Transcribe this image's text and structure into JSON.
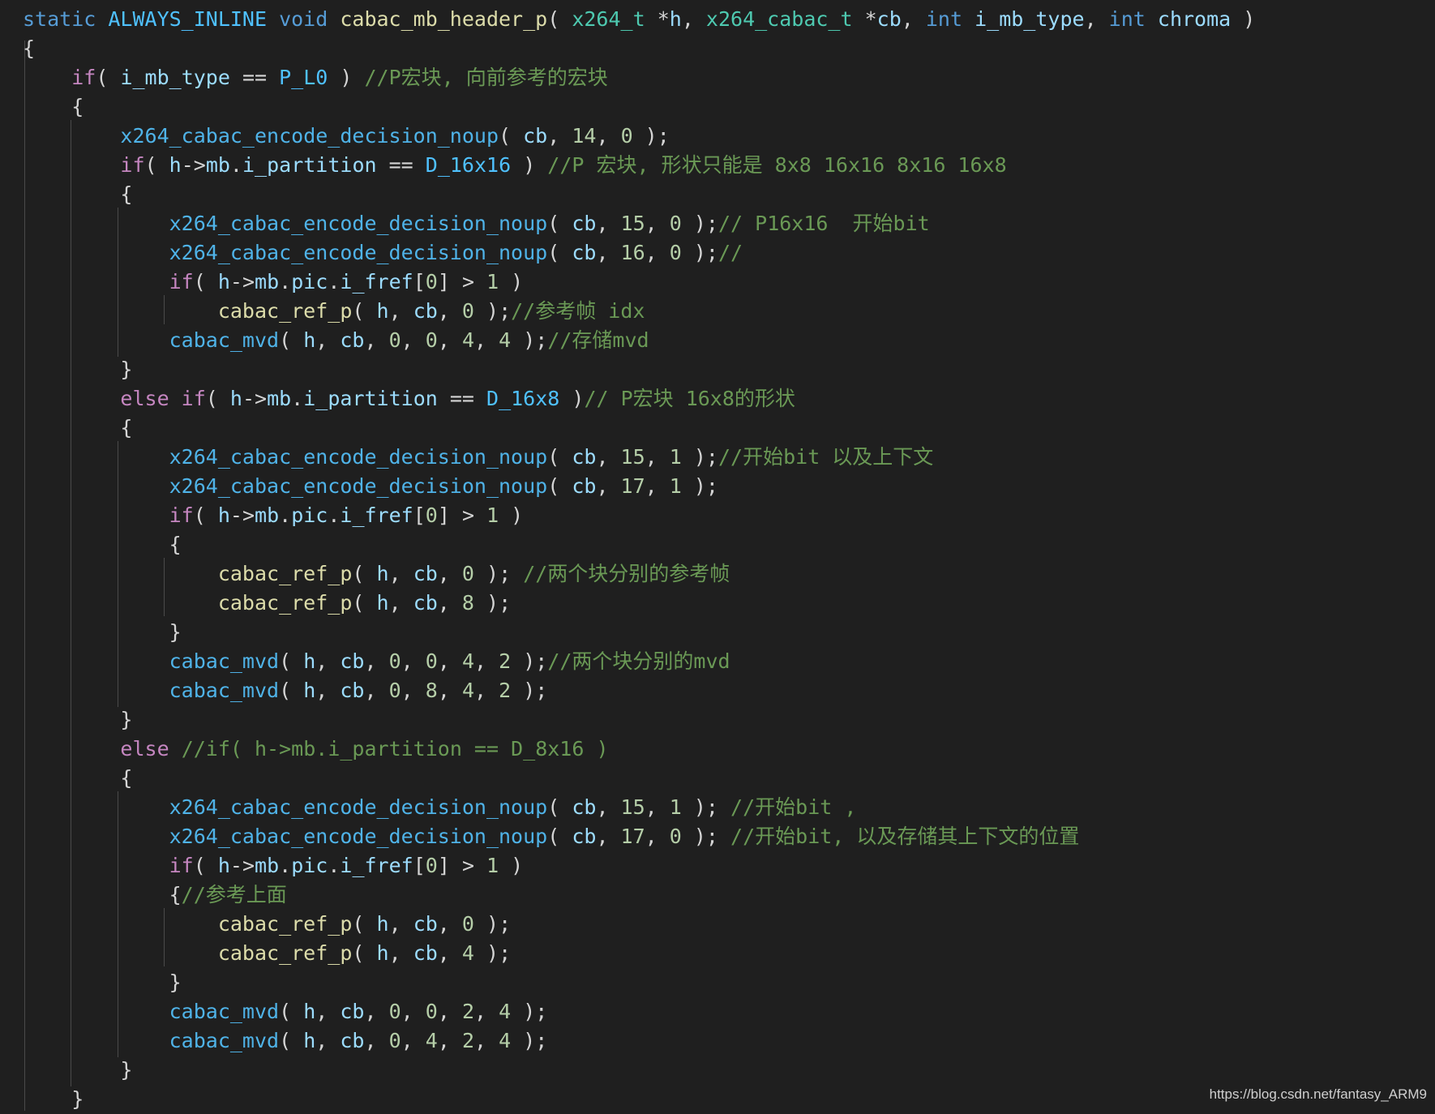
{
  "colors": {
    "background": "#1f1f1f",
    "keyword": "#569cd6",
    "control": "#c586c0",
    "function": "#dcdcaa",
    "api_function": "#4fb3e8",
    "type": "#4ec9b0",
    "variable": "#9cdcfe",
    "number": "#b5cea8",
    "macro": "#4fc1ff",
    "comment": "#6a9955",
    "plain": "#d4d4d4"
  },
  "lines": [
    [
      [
        "kw",
        "static "
      ],
      [
        "mac",
        "ALWAYS_INLINE "
      ],
      [
        "kw",
        "void "
      ],
      [
        "fn",
        "cabac_mb_header_p"
      ],
      [
        "pl",
        "( "
      ],
      [
        "ty",
        "x264_t "
      ],
      [
        "pl",
        "*"
      ],
      [
        "var",
        "h"
      ],
      [
        "pl",
        ", "
      ],
      [
        "ty",
        "x264_cabac_t "
      ],
      [
        "pl",
        "*"
      ],
      [
        "var",
        "cb"
      ],
      [
        "pl",
        ", "
      ],
      [
        "kw",
        "int "
      ],
      [
        "var",
        "i_mb_type"
      ],
      [
        "pl",
        ", "
      ],
      [
        "kw",
        "int "
      ],
      [
        "var",
        "chroma"
      ],
      [
        "pl",
        " )"
      ]
    ],
    [
      [
        "pl",
        "{"
      ]
    ],
    [
      [
        "pl",
        "    "
      ],
      [
        "ctl",
        "if"
      ],
      [
        "pl",
        "( "
      ],
      [
        "var",
        "i_mb_type"
      ],
      [
        "pl",
        " == "
      ],
      [
        "mac",
        "P_L0"
      ],
      [
        "pl",
        " ) "
      ],
      [
        "cmt",
        "//P宏块, 向前参考的宏块"
      ]
    ],
    [
      [
        "pl",
        "    {"
      ]
    ],
    [
      [
        "pl",
        "        "
      ],
      [
        "fn2",
        "x264_cabac_encode_decision_noup"
      ],
      [
        "pl",
        "( "
      ],
      [
        "var",
        "cb"
      ],
      [
        "pl",
        ", "
      ],
      [
        "num",
        "14"
      ],
      [
        "pl",
        ", "
      ],
      [
        "num",
        "0"
      ],
      [
        "pl",
        " );"
      ]
    ],
    [
      [
        "pl",
        "        "
      ],
      [
        "ctl",
        "if"
      ],
      [
        "pl",
        "( "
      ],
      [
        "var",
        "h"
      ],
      [
        "pl",
        "->"
      ],
      [
        "var",
        "mb"
      ],
      [
        "pl",
        "."
      ],
      [
        "var",
        "i_partition"
      ],
      [
        "pl",
        " == "
      ],
      [
        "mac",
        "D_16x16"
      ],
      [
        "pl",
        " ) "
      ],
      [
        "cmt",
        "//P 宏块, 形状只能是 8x8 16x16 8x16 16x8"
      ]
    ],
    [
      [
        "pl",
        "        {"
      ]
    ],
    [
      [
        "pl",
        "            "
      ],
      [
        "fn2",
        "x264_cabac_encode_decision_noup"
      ],
      [
        "pl",
        "( "
      ],
      [
        "var",
        "cb"
      ],
      [
        "pl",
        ", "
      ],
      [
        "num",
        "15"
      ],
      [
        "pl",
        ", "
      ],
      [
        "num",
        "0"
      ],
      [
        "pl",
        " );"
      ],
      [
        "cmt",
        "// P16x16  开始bit"
      ]
    ],
    [
      [
        "pl",
        "            "
      ],
      [
        "fn2",
        "x264_cabac_encode_decision_noup"
      ],
      [
        "pl",
        "( "
      ],
      [
        "var",
        "cb"
      ],
      [
        "pl",
        ", "
      ],
      [
        "num",
        "16"
      ],
      [
        "pl",
        ", "
      ],
      [
        "num",
        "0"
      ],
      [
        "pl",
        " );"
      ],
      [
        "cmt",
        "//"
      ]
    ],
    [
      [
        "pl",
        "            "
      ],
      [
        "ctl",
        "if"
      ],
      [
        "pl",
        "( "
      ],
      [
        "var",
        "h"
      ],
      [
        "pl",
        "->"
      ],
      [
        "var",
        "mb"
      ],
      [
        "pl",
        "."
      ],
      [
        "var",
        "pic"
      ],
      [
        "pl",
        "."
      ],
      [
        "var",
        "i_fref"
      ],
      [
        "pl",
        "["
      ],
      [
        "num",
        "0"
      ],
      [
        "pl",
        "] > "
      ],
      [
        "num",
        "1"
      ],
      [
        "pl",
        " )"
      ]
    ],
    [
      [
        "pl",
        "                "
      ],
      [
        "fn",
        "cabac_ref_p"
      ],
      [
        "pl",
        "( "
      ],
      [
        "var",
        "h"
      ],
      [
        "pl",
        ", "
      ],
      [
        "var",
        "cb"
      ],
      [
        "pl",
        ", "
      ],
      [
        "num",
        "0"
      ],
      [
        "pl",
        " );"
      ],
      [
        "cmt",
        "//参考帧 idx"
      ]
    ],
    [
      [
        "pl",
        "            "
      ],
      [
        "fn2",
        "cabac_mvd"
      ],
      [
        "pl",
        "( "
      ],
      [
        "var",
        "h"
      ],
      [
        "pl",
        ", "
      ],
      [
        "var",
        "cb"
      ],
      [
        "pl",
        ", "
      ],
      [
        "num",
        "0"
      ],
      [
        "pl",
        ", "
      ],
      [
        "num",
        "0"
      ],
      [
        "pl",
        ", "
      ],
      [
        "num",
        "4"
      ],
      [
        "pl",
        ", "
      ],
      [
        "num",
        "4"
      ],
      [
        "pl",
        " );"
      ],
      [
        "cmt",
        "//存储mvd"
      ]
    ],
    [
      [
        "pl",
        "        }"
      ]
    ],
    [
      [
        "pl",
        "        "
      ],
      [
        "ctl",
        "else if"
      ],
      [
        "pl",
        "( "
      ],
      [
        "var",
        "h"
      ],
      [
        "pl",
        "->"
      ],
      [
        "var",
        "mb"
      ],
      [
        "pl",
        "."
      ],
      [
        "var",
        "i_partition"
      ],
      [
        "pl",
        " == "
      ],
      [
        "mac",
        "D_16x8"
      ],
      [
        "pl",
        " )"
      ],
      [
        "cmt",
        "// P宏块 16x8的形状"
      ]
    ],
    [
      [
        "pl",
        "        {"
      ]
    ],
    [
      [
        "pl",
        "            "
      ],
      [
        "fn2",
        "x264_cabac_encode_decision_noup"
      ],
      [
        "pl",
        "( "
      ],
      [
        "var",
        "cb"
      ],
      [
        "pl",
        ", "
      ],
      [
        "num",
        "15"
      ],
      [
        "pl",
        ", "
      ],
      [
        "num",
        "1"
      ],
      [
        "pl",
        " );"
      ],
      [
        "cmt",
        "//开始bit 以及上下文"
      ]
    ],
    [
      [
        "pl",
        "            "
      ],
      [
        "fn2",
        "x264_cabac_encode_decision_noup"
      ],
      [
        "pl",
        "( "
      ],
      [
        "var",
        "cb"
      ],
      [
        "pl",
        ", "
      ],
      [
        "num",
        "17"
      ],
      [
        "pl",
        ", "
      ],
      [
        "num",
        "1"
      ],
      [
        "pl",
        " );"
      ]
    ],
    [
      [
        "pl",
        "            "
      ],
      [
        "ctl",
        "if"
      ],
      [
        "pl",
        "( "
      ],
      [
        "var",
        "h"
      ],
      [
        "pl",
        "->"
      ],
      [
        "var",
        "mb"
      ],
      [
        "pl",
        "."
      ],
      [
        "var",
        "pic"
      ],
      [
        "pl",
        "."
      ],
      [
        "var",
        "i_fref"
      ],
      [
        "pl",
        "["
      ],
      [
        "num",
        "0"
      ],
      [
        "pl",
        "] > "
      ],
      [
        "num",
        "1"
      ],
      [
        "pl",
        " )"
      ]
    ],
    [
      [
        "pl",
        "            {"
      ]
    ],
    [
      [
        "pl",
        "                "
      ],
      [
        "fn",
        "cabac_ref_p"
      ],
      [
        "pl",
        "( "
      ],
      [
        "var",
        "h"
      ],
      [
        "pl",
        ", "
      ],
      [
        "var",
        "cb"
      ],
      [
        "pl",
        ", "
      ],
      [
        "num",
        "0"
      ],
      [
        "pl",
        " ); "
      ],
      [
        "cmt",
        "//两个块分别的参考帧"
      ]
    ],
    [
      [
        "pl",
        "                "
      ],
      [
        "fn",
        "cabac_ref_p"
      ],
      [
        "pl",
        "( "
      ],
      [
        "var",
        "h"
      ],
      [
        "pl",
        ", "
      ],
      [
        "var",
        "cb"
      ],
      [
        "pl",
        ", "
      ],
      [
        "num",
        "8"
      ],
      [
        "pl",
        " );"
      ]
    ],
    [
      [
        "pl",
        "            }"
      ]
    ],
    [
      [
        "pl",
        "            "
      ],
      [
        "fn2",
        "cabac_mvd"
      ],
      [
        "pl",
        "( "
      ],
      [
        "var",
        "h"
      ],
      [
        "pl",
        ", "
      ],
      [
        "var",
        "cb"
      ],
      [
        "pl",
        ", "
      ],
      [
        "num",
        "0"
      ],
      [
        "pl",
        ", "
      ],
      [
        "num",
        "0"
      ],
      [
        "pl",
        ", "
      ],
      [
        "num",
        "4"
      ],
      [
        "pl",
        ", "
      ],
      [
        "num",
        "2"
      ],
      [
        "pl",
        " );"
      ],
      [
        "cmt",
        "//两个块分别的mvd"
      ]
    ],
    [
      [
        "pl",
        "            "
      ],
      [
        "fn2",
        "cabac_mvd"
      ],
      [
        "pl",
        "( "
      ],
      [
        "var",
        "h"
      ],
      [
        "pl",
        ", "
      ],
      [
        "var",
        "cb"
      ],
      [
        "pl",
        ", "
      ],
      [
        "num",
        "0"
      ],
      [
        "pl",
        ", "
      ],
      [
        "num",
        "8"
      ],
      [
        "pl",
        ", "
      ],
      [
        "num",
        "4"
      ],
      [
        "pl",
        ", "
      ],
      [
        "num",
        "2"
      ],
      [
        "pl",
        " );"
      ]
    ],
    [
      [
        "pl",
        "        }"
      ]
    ],
    [
      [
        "pl",
        "        "
      ],
      [
        "ctl",
        "else"
      ],
      [
        "pl",
        " "
      ],
      [
        "cmt",
        "//if( h->mb.i_partition == D_8x16 )"
      ]
    ],
    [
      [
        "pl",
        "        {"
      ]
    ],
    [
      [
        "pl",
        "            "
      ],
      [
        "fn2",
        "x264_cabac_encode_decision_noup"
      ],
      [
        "pl",
        "( "
      ],
      [
        "var",
        "cb"
      ],
      [
        "pl",
        ", "
      ],
      [
        "num",
        "15"
      ],
      [
        "pl",
        ", "
      ],
      [
        "num",
        "1"
      ],
      [
        "pl",
        " ); "
      ],
      [
        "cmt",
        "//开始bit ,"
      ]
    ],
    [
      [
        "pl",
        "            "
      ],
      [
        "fn2",
        "x264_cabac_encode_decision_noup"
      ],
      [
        "pl",
        "( "
      ],
      [
        "var",
        "cb"
      ],
      [
        "pl",
        ", "
      ],
      [
        "num",
        "17"
      ],
      [
        "pl",
        ", "
      ],
      [
        "num",
        "0"
      ],
      [
        "pl",
        " ); "
      ],
      [
        "cmt",
        "//开始bit, 以及存储其上下文的位置"
      ]
    ],
    [
      [
        "pl",
        "            "
      ],
      [
        "ctl",
        "if"
      ],
      [
        "pl",
        "( "
      ],
      [
        "var",
        "h"
      ],
      [
        "pl",
        "->"
      ],
      [
        "var",
        "mb"
      ],
      [
        "pl",
        "."
      ],
      [
        "var",
        "pic"
      ],
      [
        "pl",
        "."
      ],
      [
        "var",
        "i_fref"
      ],
      [
        "pl",
        "["
      ],
      [
        "num",
        "0"
      ],
      [
        "pl",
        "] > "
      ],
      [
        "num",
        "1"
      ],
      [
        "pl",
        " )"
      ]
    ],
    [
      [
        "pl",
        "            {"
      ],
      [
        "cmt",
        "//参考上面"
      ]
    ],
    [
      [
        "pl",
        "                "
      ],
      [
        "fn",
        "cabac_ref_p"
      ],
      [
        "pl",
        "( "
      ],
      [
        "var",
        "h"
      ],
      [
        "pl",
        ", "
      ],
      [
        "var",
        "cb"
      ],
      [
        "pl",
        ", "
      ],
      [
        "num",
        "0"
      ],
      [
        "pl",
        " );"
      ]
    ],
    [
      [
        "pl",
        "                "
      ],
      [
        "fn",
        "cabac_ref_p"
      ],
      [
        "pl",
        "( "
      ],
      [
        "var",
        "h"
      ],
      [
        "pl",
        ", "
      ],
      [
        "var",
        "cb"
      ],
      [
        "pl",
        ", "
      ],
      [
        "num",
        "4"
      ],
      [
        "pl",
        " );"
      ]
    ],
    [
      [
        "pl",
        "            }"
      ]
    ],
    [
      [
        "pl",
        "            "
      ],
      [
        "fn2",
        "cabac_mvd"
      ],
      [
        "pl",
        "( "
      ],
      [
        "var",
        "h"
      ],
      [
        "pl",
        ", "
      ],
      [
        "var",
        "cb"
      ],
      [
        "pl",
        ", "
      ],
      [
        "num",
        "0"
      ],
      [
        "pl",
        ", "
      ],
      [
        "num",
        "0"
      ],
      [
        "pl",
        ", "
      ],
      [
        "num",
        "2"
      ],
      [
        "pl",
        ", "
      ],
      [
        "num",
        "4"
      ],
      [
        "pl",
        " );"
      ]
    ],
    [
      [
        "pl",
        "            "
      ],
      [
        "fn2",
        "cabac_mvd"
      ],
      [
        "pl",
        "( "
      ],
      [
        "var",
        "h"
      ],
      [
        "pl",
        ", "
      ],
      [
        "var",
        "cb"
      ],
      [
        "pl",
        ", "
      ],
      [
        "num",
        "0"
      ],
      [
        "pl",
        ", "
      ],
      [
        "num",
        "4"
      ],
      [
        "pl",
        ", "
      ],
      [
        "num",
        "2"
      ],
      [
        "pl",
        ", "
      ],
      [
        "num",
        "4"
      ],
      [
        "pl",
        " );"
      ]
    ],
    [
      [
        "pl",
        "        }"
      ]
    ],
    [
      [
        "pl",
        "    }"
      ]
    ]
  ],
  "watermark": "https://blog.csdn.net/fantasy_ARM9"
}
